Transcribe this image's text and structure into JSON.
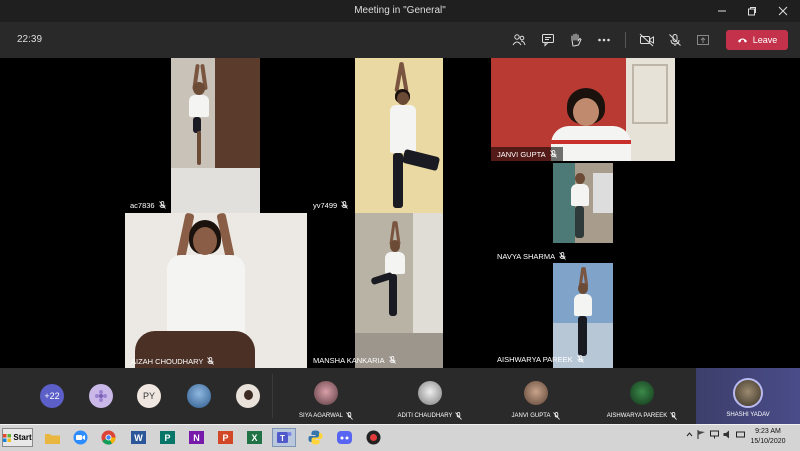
{
  "window": {
    "title": "Meeting in \"General\""
  },
  "toolbar": {
    "timer": "22:39",
    "leave_label": "Leave",
    "leave_color": "#c4314b"
  },
  "tiles": [
    {
      "name": "ac7836"
    },
    {
      "name": "yv7499"
    },
    {
      "name": "JANVI GUPTA"
    },
    {
      "name": "AIZAH CHOUDHARY"
    },
    {
      "name": "MANSHA KANKARIA"
    },
    {
      "name": "NAVYA SHARMA"
    },
    {
      "name": "AISHWARYA PAREEK"
    }
  ],
  "participants": {
    "overflow_count": "+22",
    "initials": "PY",
    "named": [
      {
        "name": "SIYA AGARWAL"
      },
      {
        "name": "ADITI CHAUDHARY"
      },
      {
        "name": "JANVI GUPTA"
      },
      {
        "name": "AISHWARYA PAREEK"
      },
      {
        "name": "SHASHI YADAV"
      }
    ]
  },
  "taskbar": {
    "start_label": "Start",
    "time": "9:23 AM",
    "date": "15/10/2020"
  }
}
